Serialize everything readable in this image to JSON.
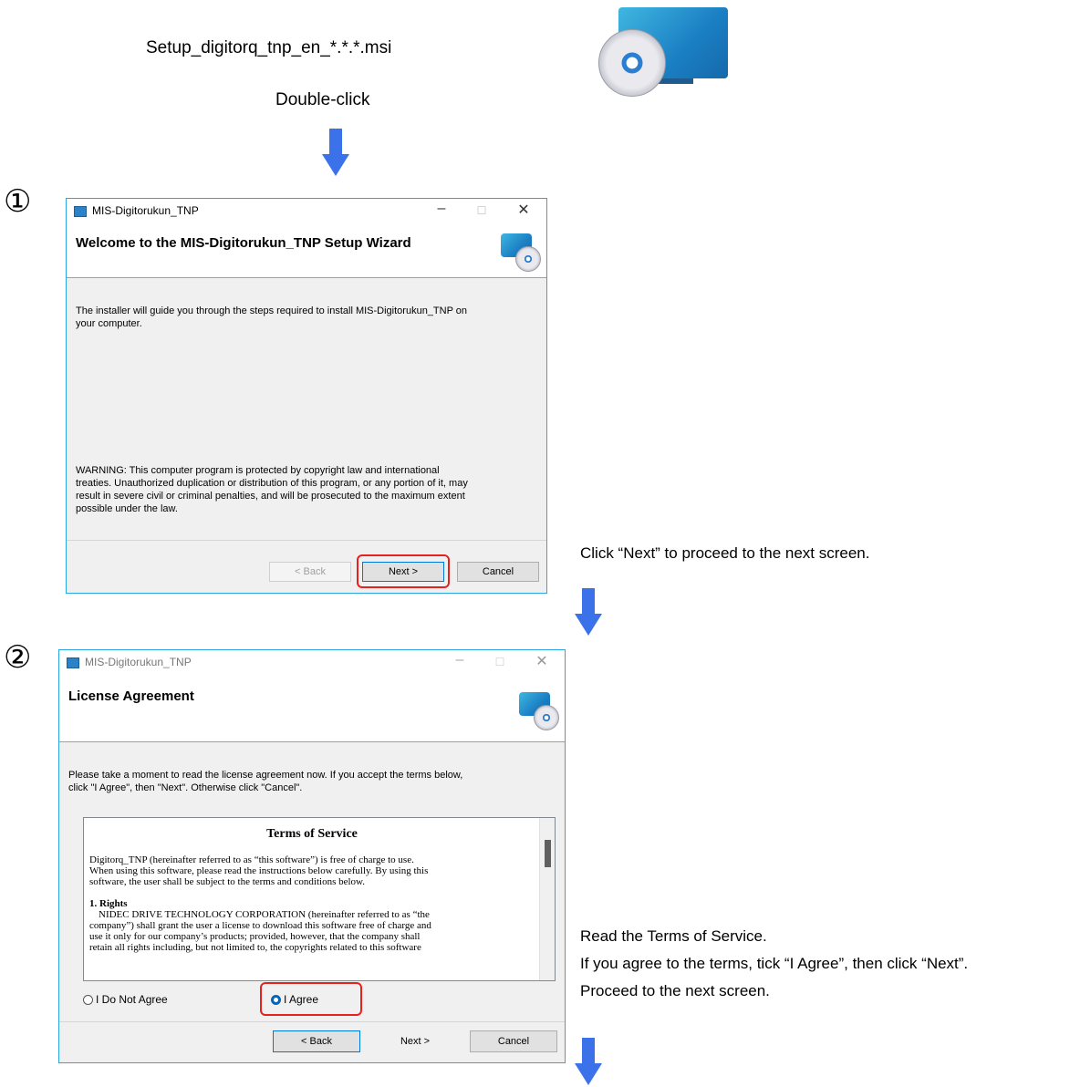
{
  "top": {
    "file_name": "Setup_digitorq_tnp_en_*.*.*.msi",
    "action": "Double-click"
  },
  "step1": {
    "number": "①",
    "window_title": "MIS-Digitorukun_TNP",
    "heading": "Welcome to the MIS-Digitorukun_TNP Setup Wizard",
    "intro_lines": [
      "The installer will guide you through the steps required to install MIS-Digitorukun_TNP on",
      "your computer."
    ],
    "warning_lines": [
      "WARNING: This computer program is protected by copyright law and international",
      "treaties. Unauthorized duplication or distribution of this program, or any portion of it, may",
      "result in severe civil or criminal penalties, and will be prosecuted to the maximum extent",
      "possible under the law."
    ],
    "back_label": "< Back",
    "next_label": "Next >",
    "cancel_label": "Cancel",
    "instruction": "Click “Next” to proceed to the next screen."
  },
  "step2": {
    "number": "②",
    "window_title": "MIS-Digitorukun_TNP",
    "heading": "License Agreement",
    "intro_lines": [
      "Please take a moment to read the license agreement now. If you accept the terms below,",
      "click \"I Agree\", then \"Next\". Otherwise click \"Cancel\"."
    ],
    "terms_title": "Terms of Service",
    "terms_para1": [
      "Digitorq_TNP (hereinafter referred to as “this software”) is free of charge to use.",
      "When using this software, please read the instructions below carefully.  By using this",
      "software, the user shall be subject to the terms and conditions below."
    ],
    "rights_heading": "1. Rights",
    "rights_lines": [
      "NIDEC DRIVE TECHNOLOGY CORPORATION (hereinafter referred to as “the",
      "company”) shall grant the user a license to download this software free of charge and",
      "use it only for our company’s products; provided, however, that the company shall",
      "retain all rights including, but not limited to, the copyrights related to this software"
    ],
    "radio_disagree": "I Do Not Agree",
    "radio_agree": "I Agree",
    "back_label": "< Back",
    "next_label": "Next >",
    "cancel_label": "Cancel",
    "instructions": [
      "Read the Terms of Service.",
      "If you agree to the terms, tick “I Agree”, then click “Next”.",
      "Proceed to the next screen."
    ]
  },
  "colors": {
    "arrow": "#3b72ea",
    "highlight": "#e8201e",
    "window_border": "#2aa6e0"
  },
  "icons": [
    "setup-pc-icon",
    "down-arrow-icon",
    "app-icon",
    "minimize-icon",
    "maximize-icon",
    "close-icon"
  ]
}
